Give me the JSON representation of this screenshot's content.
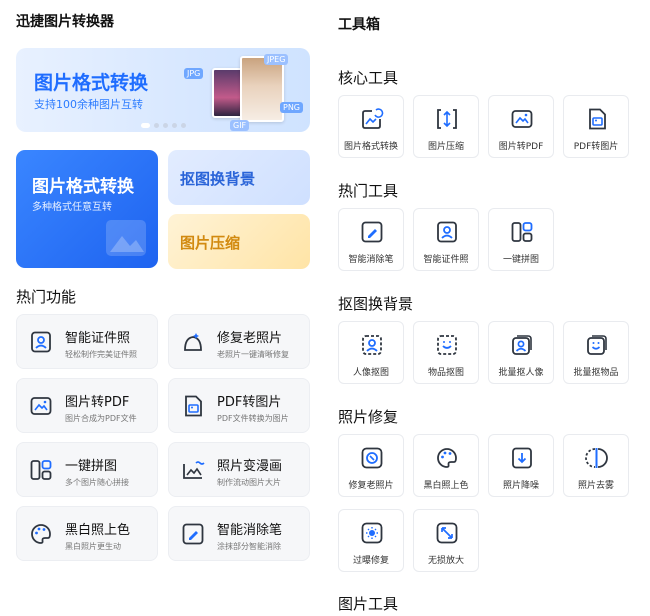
{
  "app_title": "迅捷图片转换器",
  "banner": {
    "title": "图片格式转换",
    "subtitle": "支持100余种图片互转",
    "tags": [
      "JPG",
      "PNG",
      "JPEG",
      "GIF"
    ]
  },
  "cards": {
    "format": {
      "title": "图片格式转换",
      "subtitle": "多种格式任意互转"
    },
    "bg_remove": {
      "title": "抠图换背景"
    },
    "compress": {
      "title": "图片压缩"
    }
  },
  "hot_functions": {
    "title": "热门功能",
    "items": [
      {
        "name": "智能证件照",
        "desc": "轻松制作完美证件照",
        "icon": "id-photo-icon"
      },
      {
        "name": "修复老照片",
        "desc": "老照片一键清晰修复",
        "icon": "restore-icon"
      },
      {
        "name": "图片转PDF",
        "desc": "图片合成为PDF文件",
        "icon": "image-to-pdf-icon"
      },
      {
        "name": "PDF转图片",
        "desc": "PDF文件转换为图片",
        "icon": "pdf-to-image-icon"
      },
      {
        "name": "一键拼图",
        "desc": "多个图片随心拼接",
        "icon": "collage-icon"
      },
      {
        "name": "照片变漫画",
        "desc": "制作流动图片大片",
        "icon": "cartoon-icon"
      },
      {
        "name": "黑白照上色",
        "desc": "黑白照片更生动",
        "icon": "colorize-icon"
      },
      {
        "name": "智能消除笔",
        "desc": "涂抹部分智能消除",
        "icon": "eraser-pen-icon"
      }
    ]
  },
  "toolbox": {
    "title": "工具箱",
    "sections": [
      {
        "title": "核心工具",
        "items": [
          {
            "label": "图片格式转换",
            "icon": "convert-icon"
          },
          {
            "label": "图片压缩",
            "icon": "compress-icon"
          },
          {
            "label": "图片转PDF",
            "icon": "image-to-pdf-icon"
          },
          {
            "label": "PDF转图片",
            "icon": "pdf-to-image-icon"
          }
        ]
      },
      {
        "title": "热门工具",
        "items": [
          {
            "label": "智能消除笔",
            "icon": "eraser-pen-icon"
          },
          {
            "label": "智能证件照",
            "icon": "id-photo-icon"
          },
          {
            "label": "一键拼图",
            "icon": "collage-icon"
          }
        ]
      },
      {
        "title": "抠图换背景",
        "items": [
          {
            "label": "人像抠图",
            "icon": "portrait-cutout-icon"
          },
          {
            "label": "物品抠图",
            "icon": "object-cutout-icon"
          },
          {
            "label": "批量抠人像",
            "icon": "batch-portrait-icon"
          },
          {
            "label": "批量抠物品",
            "icon": "batch-object-icon"
          }
        ]
      },
      {
        "title": "照片修复",
        "items": [
          {
            "label": "修复老照片",
            "icon": "restore-icon"
          },
          {
            "label": "黑白照上色",
            "icon": "colorize-icon"
          },
          {
            "label": "照片降噪",
            "icon": "denoise-icon"
          },
          {
            "label": "照片去雾",
            "icon": "dehaze-icon"
          },
          {
            "label": "过曝修复",
            "icon": "overexposure-icon"
          },
          {
            "label": "无损放大",
            "icon": "upscale-icon"
          }
        ]
      },
      {
        "title": "图片工具",
        "items": []
      }
    ]
  },
  "colors": {
    "accent": "#1f6dff",
    "icon_stroke": "#2f3640",
    "compress_text": "#d28a10"
  }
}
